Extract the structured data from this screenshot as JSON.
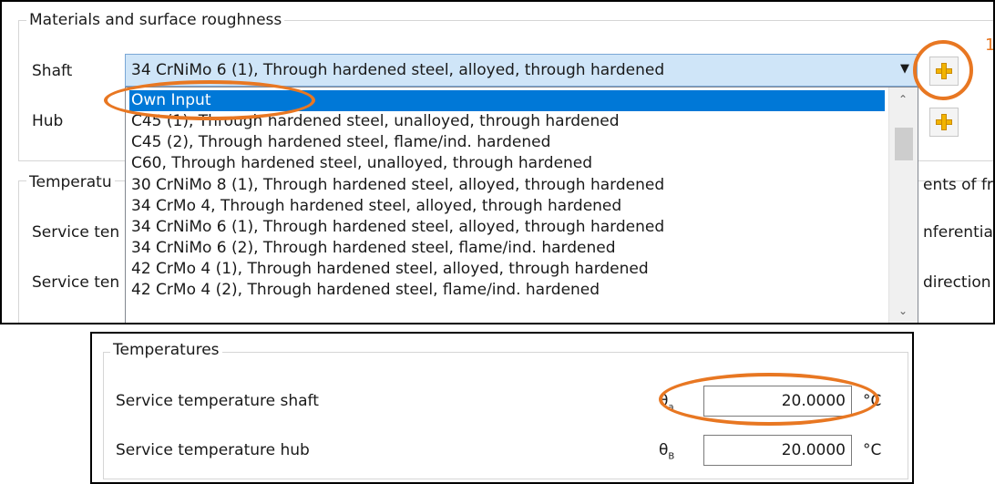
{
  "materials_group": {
    "title": "Materials and surface roughness",
    "shaft_label": "Shaft",
    "hub_label": "Hub",
    "shaft_selected": "34 CrNiMo 6 (1), Through hardened steel, alloyed, through hardened",
    "annotation_number": "1",
    "dropdown_options": [
      "Own Input",
      "C45 (1), Through hardened steel, unalloyed, through hardened",
      "C45 (2), Through hardened steel, flame/ind. hardened",
      "C60, Through hardened steel, unalloyed, through hardened",
      "30 CrNiMo 8 (1), Through hardened steel, alloyed, through hardened",
      "34 CrMo 4, Through hardened steel, alloyed, through hardened",
      "34 CrNiMo 6 (1), Through hardened steel, alloyed, through hardened",
      "34 CrNiMo 6 (2), Through hardened steel, flame/ind. hardened",
      "42 CrMo 4 (1), Through hardened steel, alloyed, through hardened",
      "42 CrMo 4 (2), Through hardened steel, flame/ind. hardened"
    ]
  },
  "background_partial": {
    "temperatures_title": "Temperatu",
    "service_temp_1": "Service ten",
    "service_temp_2": "Service ten",
    "coefficients_title": "ents of fr",
    "circumferential": "nferential",
    "direction": "direction"
  },
  "temperatures": {
    "title": "Temperatures",
    "rows": [
      {
        "label": "Service temperature shaft",
        "symbol": "θ",
        "subscript": "a",
        "value": "20.0000",
        "unit": "°C"
      },
      {
        "label": "Service temperature hub",
        "symbol": "θ",
        "subscript": "B",
        "value": "20.0000",
        "unit": "°C"
      }
    ]
  },
  "colors": {
    "highlight": "#e87722",
    "selection": "#0078d7",
    "combo_bg": "#cfe5f8"
  }
}
